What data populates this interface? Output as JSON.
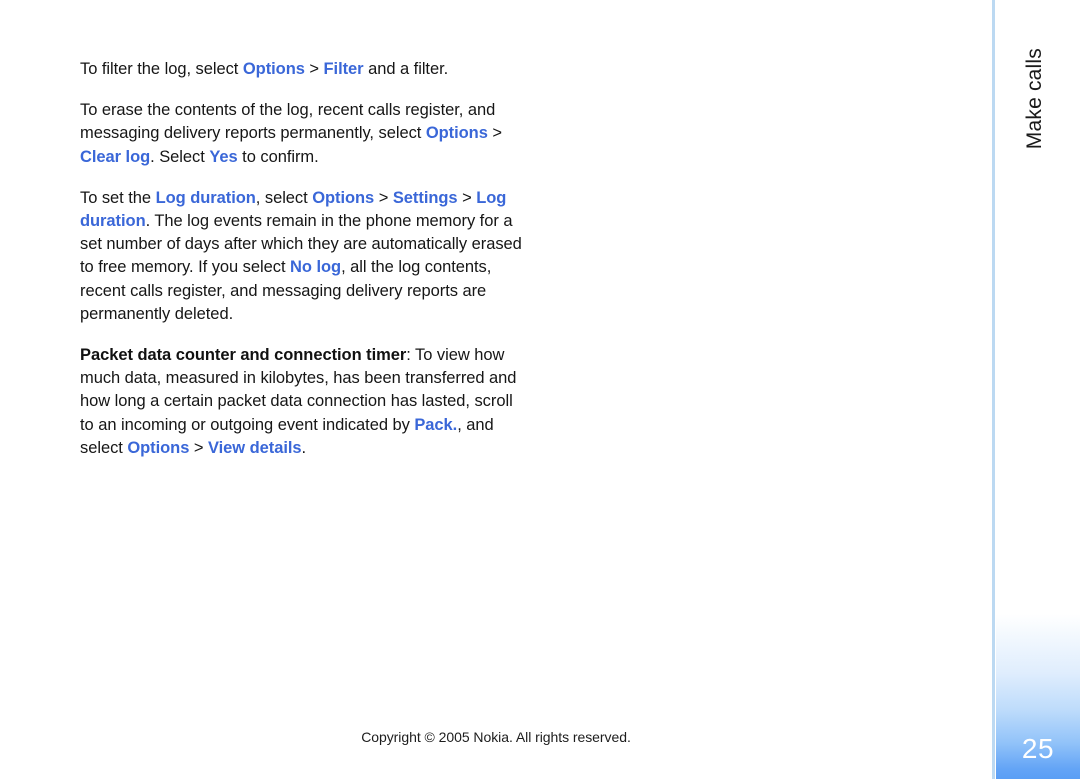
{
  "page": {
    "chapter_label": "Make calls",
    "folio": "25",
    "copyright": "Copyright © 2005 Nokia. All rights reserved."
  },
  "colors": {
    "ui_term": "#3a67d8",
    "body_text": "#161616",
    "rule": "#bcd9f2",
    "folio_gradient_end": "#5a9ef5",
    "folio_text": "#ffffff"
  },
  "body": {
    "paragraphs": [
      {
        "id": "filter-log",
        "runs": [
          {
            "text": "To filter the log, select ",
            "style": "normal"
          },
          {
            "text": "Options",
            "style": "ui"
          },
          {
            "text": " > ",
            "style": "normal"
          },
          {
            "text": "Filter",
            "style": "ui"
          },
          {
            "text": " and a filter.",
            "style": "normal"
          }
        ]
      },
      {
        "id": "erase-log",
        "runs": [
          {
            "text": "To erase the contents of the log, recent calls register, and messaging delivery reports permanently, select ",
            "style": "normal"
          },
          {
            "text": "Options",
            "style": "ui"
          },
          {
            "text": " > ",
            "style": "normal"
          },
          {
            "text": "Clear log",
            "style": "ui"
          },
          {
            "text": ". Select ",
            "style": "normal"
          },
          {
            "text": "Yes",
            "style": "ui"
          },
          {
            "text": " to confirm.",
            "style": "normal"
          }
        ]
      },
      {
        "id": "log-duration",
        "runs": [
          {
            "text": "To set the ",
            "style": "normal"
          },
          {
            "text": "Log duration",
            "style": "ui"
          },
          {
            "text": ", select ",
            "style": "normal"
          },
          {
            "text": "Options",
            "style": "ui"
          },
          {
            "text": " > ",
            "style": "normal"
          },
          {
            "text": "Settings",
            "style": "ui"
          },
          {
            "text": " > ",
            "style": "normal"
          },
          {
            "text": "Log duration",
            "style": "ui"
          },
          {
            "text": ". The log events remain in the phone memory for a set number of days after which they are automatically erased to free memory. If you select ",
            "style": "normal"
          },
          {
            "text": "No log",
            "style": "ui"
          },
          {
            "text": ", all the log contents, recent calls register, and messaging delivery reports are permanently deleted.",
            "style": "normal"
          }
        ]
      },
      {
        "id": "packet-data-counter",
        "runs": [
          {
            "text": "Packet data counter and connection timer",
            "style": "lead"
          },
          {
            "text": ": To view how much data, measured in kilobytes, has been transferred and how long a certain packet data connection has lasted, scroll to an incoming or outgoing event indicated by ",
            "style": "normal"
          },
          {
            "text": "Pack.",
            "style": "ui"
          },
          {
            "text": ", and select ",
            "style": "normal"
          },
          {
            "text": "Options",
            "style": "ui"
          },
          {
            "text": " > ",
            "style": "normal"
          },
          {
            "text": "View details",
            "style": "ui"
          },
          {
            "text": ".",
            "style": "normal"
          }
        ]
      }
    ]
  }
}
